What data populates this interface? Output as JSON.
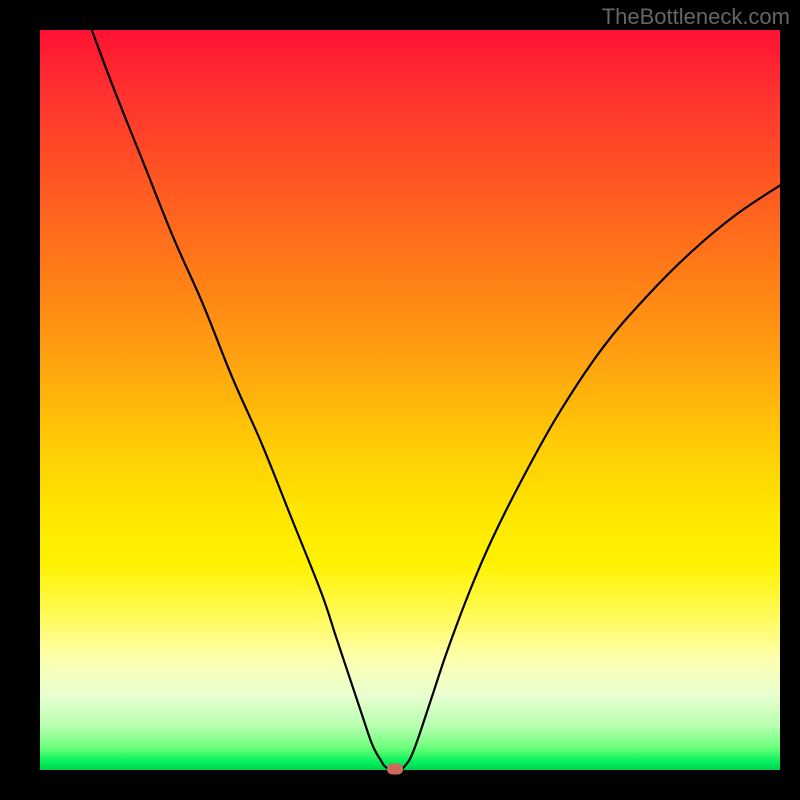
{
  "watermark": "TheBottleneck.com",
  "chart_data": {
    "type": "line",
    "title": "",
    "xlabel": "",
    "ylabel": "",
    "xlim": [
      0,
      100
    ],
    "ylim": [
      0,
      100
    ],
    "series": [
      {
        "name": "left-branch",
        "x": [
          7,
          10,
          14,
          18,
          22,
          26,
          30,
          34,
          38,
          40,
          42,
          43.5,
          44.5,
          45,
          45.5,
          46,
          46.5,
          47
        ],
        "values": [
          100,
          92,
          82,
          72,
          63,
          53,
          44,
          34,
          24,
          18,
          12,
          7.5,
          4.5,
          3.2,
          2.2,
          1.4,
          0.6,
          0.2
        ]
      },
      {
        "name": "right-branch",
        "x": [
          49,
          50,
          51,
          53,
          55,
          58,
          61,
          65,
          70,
          76,
          82,
          88,
          94,
          100
        ],
        "values": [
          0.2,
          1.5,
          4,
          10,
          16,
          24,
          31,
          39,
          48,
          57,
          64,
          70,
          75,
          79
        ]
      },
      {
        "name": "valley-floor",
        "x": [
          47,
          49
        ],
        "values": [
          0.2,
          0.2
        ]
      }
    ],
    "marker": {
      "x": 48,
      "y": 0.2
    },
    "background_gradient": {
      "top": "#ff1233",
      "bottom": "#00d050"
    }
  }
}
